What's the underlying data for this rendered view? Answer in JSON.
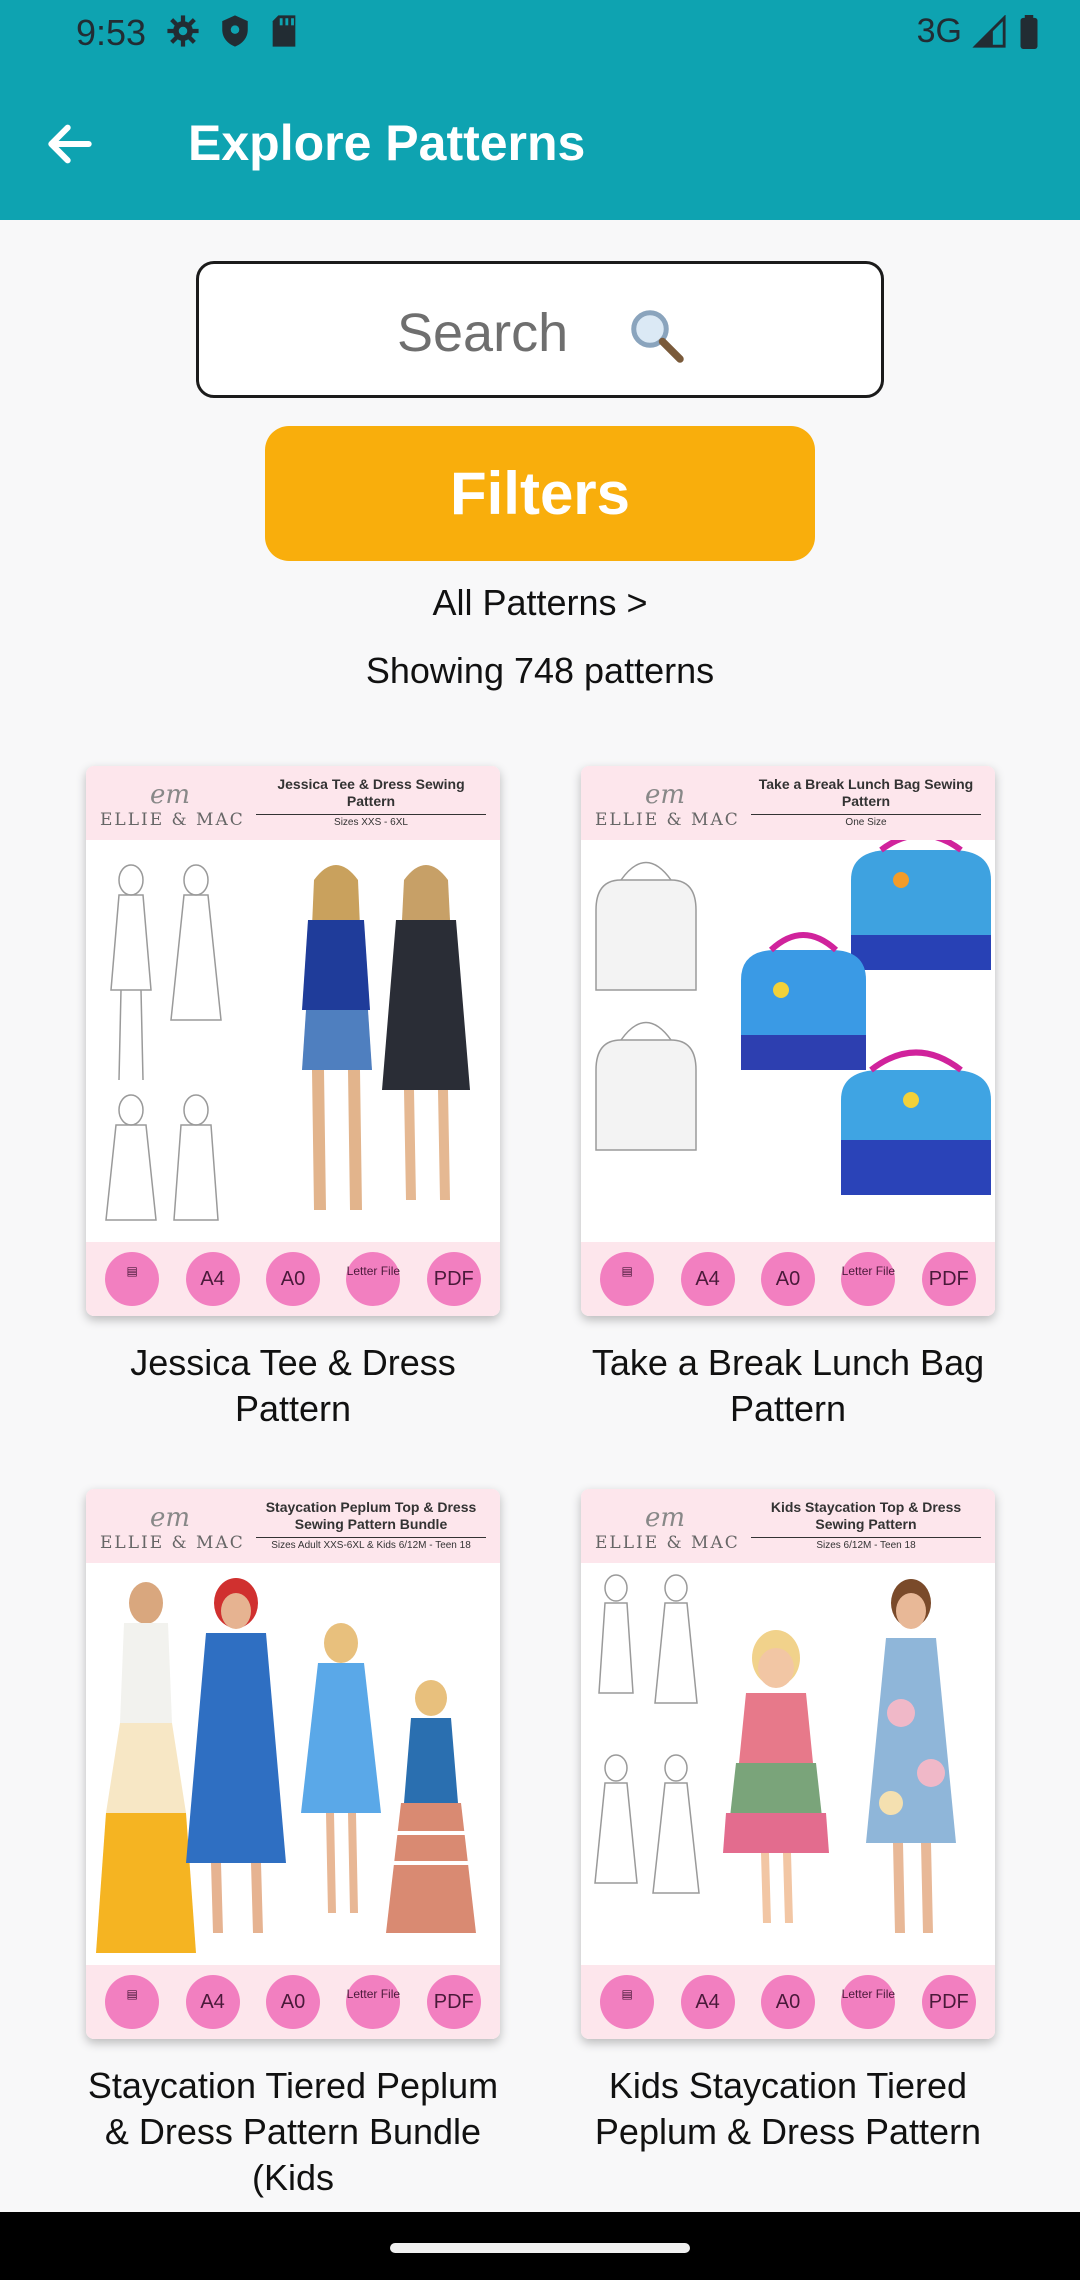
{
  "status": {
    "time": "9:53",
    "network": "3G"
  },
  "appbar": {
    "title": "Explore Patterns"
  },
  "search": {
    "placeholder": "Search"
  },
  "filters_label": "Filters",
  "breadcrumb": "All Patterns >",
  "count_text": "Showing 748 patterns",
  "card_badges": [
    "A4",
    "A0",
    "Letter File",
    "PDF"
  ],
  "patterns": [
    {
      "label": "Jessica Tee & Dress Pattern",
      "cover_title": "Jessica Tee & Dress Sewing Pattern",
      "cover_sizes": "Sizes XXS - 6XL"
    },
    {
      "label": "Take a Break Lunch Bag Pattern",
      "cover_title": "Take a Break Lunch Bag Sewing Pattern",
      "cover_sizes": "One Size"
    },
    {
      "label": "Staycation Tiered Peplum & Dress Pattern Bundle (Kids",
      "cover_title": "Staycation Peplum Top & Dress Sewing Pattern Bundle",
      "cover_sizes": "Sizes Adult XXS-6XL & Kids 6/12M - Teen 18"
    },
    {
      "label": "Kids Staycation Tiered Peplum & Dress Pattern",
      "cover_title": "Kids Staycation Top & Dress Sewing Pattern",
      "cover_sizes": "Sizes 6/12M - Teen 18"
    }
  ],
  "brand": {
    "monogram": "em",
    "name": "ELLIE & MAC"
  }
}
